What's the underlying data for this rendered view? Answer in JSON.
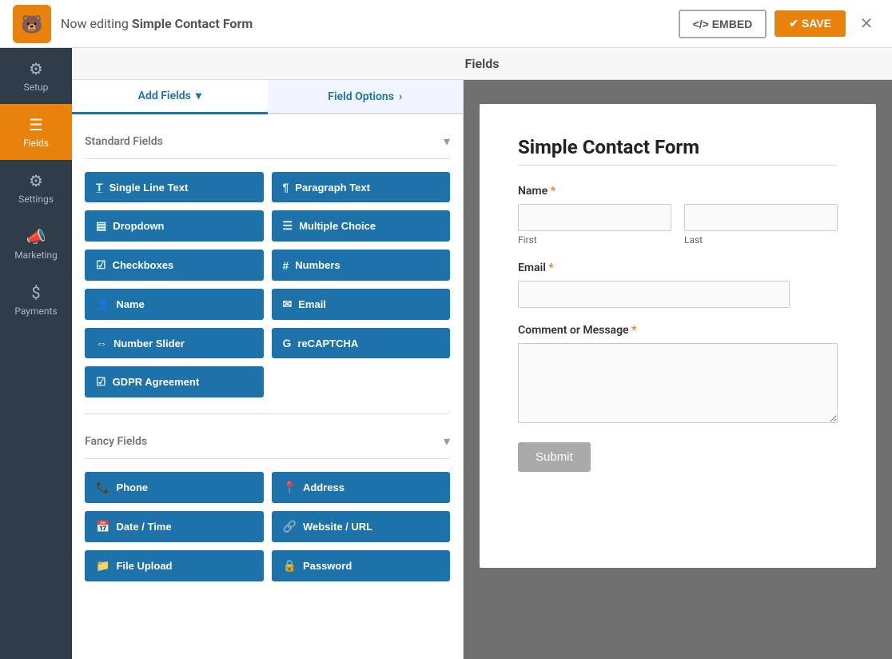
{
  "topbar": {
    "editing_prefix": "Now editing ",
    "form_name": "Simple Contact Form",
    "embed_label": "</> EMBED",
    "save_label": "✔ SAVE",
    "close_icon": "✕"
  },
  "sidebar": {
    "items": [
      {
        "id": "setup",
        "label": "Setup",
        "icon": "⚙"
      },
      {
        "id": "fields",
        "label": "Fields",
        "icon": "☰",
        "active": true
      },
      {
        "id": "settings",
        "label": "Settings",
        "icon": "⚙"
      },
      {
        "id": "marketing",
        "label": "Marketing",
        "icon": "📣"
      },
      {
        "id": "payments",
        "label": "Payments",
        "icon": "$"
      }
    ]
  },
  "fields_header": "Fields",
  "tabs": [
    {
      "id": "add-fields",
      "label": "Add Fields",
      "active": true
    },
    {
      "id": "field-options",
      "label": "Field Options"
    }
  ],
  "standard_fields": {
    "title": "Standard Fields",
    "buttons": [
      {
        "id": "single-line-text",
        "icon": "T",
        "label": "Single Line Text"
      },
      {
        "id": "paragraph-text",
        "icon": "¶",
        "label": "Paragraph Text"
      },
      {
        "id": "dropdown",
        "icon": "▤",
        "label": "Dropdown"
      },
      {
        "id": "multiple-choice",
        "icon": "☰",
        "label": "Multiple Choice"
      },
      {
        "id": "checkboxes",
        "icon": "☑",
        "label": "Checkboxes"
      },
      {
        "id": "numbers",
        "icon": "#",
        "label": "Numbers"
      },
      {
        "id": "name",
        "icon": "👤",
        "label": "Name"
      },
      {
        "id": "email",
        "icon": "✉",
        "label": "Email"
      },
      {
        "id": "number-slider",
        "icon": "⇔",
        "label": "Number Slider"
      },
      {
        "id": "recaptcha",
        "icon": "G",
        "label": "reCAPTCHA"
      },
      {
        "id": "gdpr-agreement",
        "icon": "☑",
        "label": "GDPR Agreement"
      }
    ]
  },
  "fancy_fields": {
    "title": "Fancy Fields",
    "buttons": [
      {
        "id": "phone",
        "icon": "📞",
        "label": "Phone"
      },
      {
        "id": "address",
        "icon": "📍",
        "label": "Address"
      },
      {
        "id": "date-time",
        "icon": "📅",
        "label": "Date / Time"
      },
      {
        "id": "website-url",
        "icon": "🔗",
        "label": "Website / URL"
      },
      {
        "id": "file-upload",
        "icon": "📁",
        "label": "File Upload"
      },
      {
        "id": "password",
        "icon": "🔒",
        "label": "Password"
      }
    ]
  },
  "form": {
    "title": "Simple Contact Form",
    "fields": [
      {
        "id": "name-field",
        "label": "Name",
        "required": true,
        "type": "name",
        "sublabels": [
          "First",
          "Last"
        ]
      },
      {
        "id": "email-field",
        "label": "Email",
        "required": true,
        "type": "email"
      },
      {
        "id": "comment-field",
        "label": "Comment or Message",
        "required": true,
        "type": "textarea"
      }
    ],
    "submit_label": "Submit"
  }
}
